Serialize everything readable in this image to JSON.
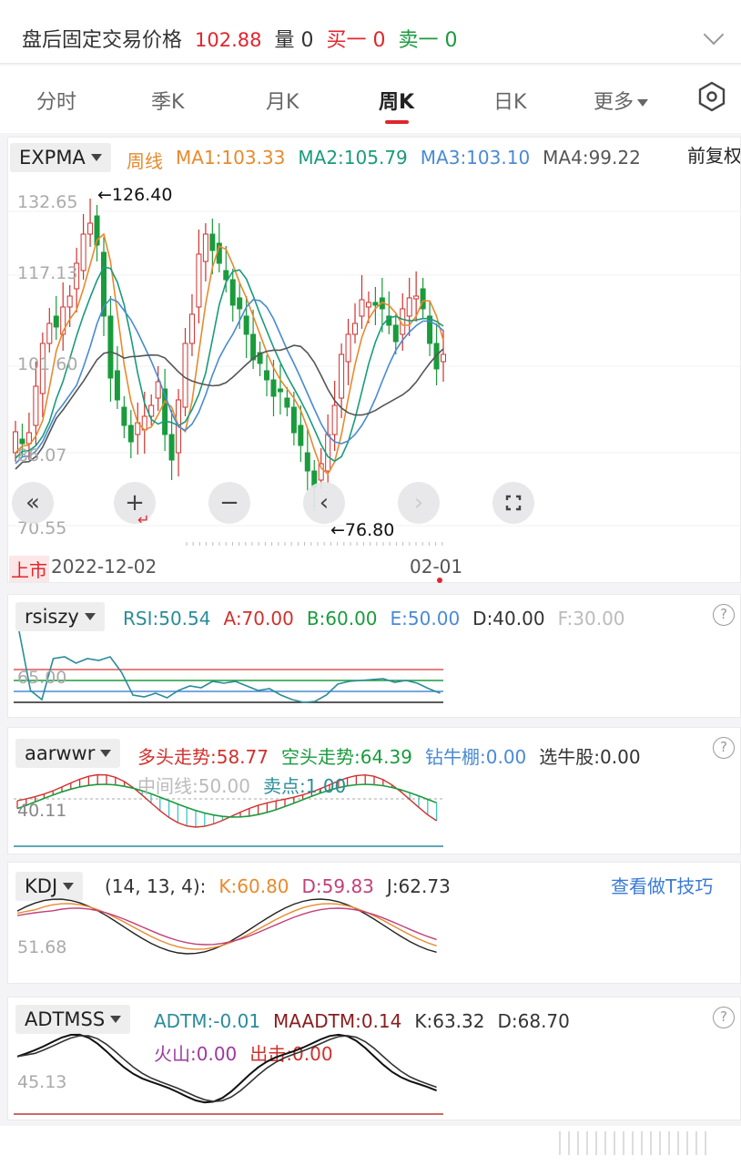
{
  "quote": {
    "after_hours_label": "盘后固定交易价格",
    "price": "102.88",
    "volume_label": "量",
    "volume": "0",
    "bid_label": "买一",
    "bid": "0",
    "ask_label": "卖一",
    "ask": "0"
  },
  "tabs": [
    {
      "label": "分时"
    },
    {
      "label": "季K"
    },
    {
      "label": "月K"
    },
    {
      "label": "周K"
    },
    {
      "label": "日K"
    },
    {
      "label": "更多"
    }
  ],
  "main_chart": {
    "indicator": "EXPMA",
    "period": "周线",
    "ma1": "MA1:103.33",
    "ma2": "MA2:105.79",
    "ma3": "MA3:103.10",
    "ma4": "MA4:99.22",
    "adjust": "前复权",
    "y_labels": [
      "132.65",
      "117.13",
      "101.60",
      "86.07",
      "70.55"
    ],
    "high_annotation": "←126.40",
    "low_annotation": "←76.80",
    "listed_label": "上市",
    "start_date": "2022-12-02",
    "end_date": "02-01",
    "controls": {
      "rewind": "«",
      "zoom_in": "+",
      "zoom_out": "−",
      "prev": "‹",
      "next": "›"
    },
    "colors": {
      "up": "#d0312d",
      "down": "#1a9b3c",
      "ma1": "#e88a2e",
      "ma2": "#1a9b7a",
      "ma3": "#4a8ad4",
      "ma4": "#555555"
    }
  },
  "rsi_panel": {
    "indicator": "rsiszy",
    "rsi": "RSI:50.54",
    "a": "A:70.00",
    "b": "B:60.00",
    "e": "E:50.00",
    "d": "D:40.00",
    "f": "F:30.00",
    "y_label": "65.00"
  },
  "aar_panel": {
    "indicator": "aarwwr",
    "bull": "多头走势:58.77",
    "bear": "空头走势:64.39",
    "drill": "钻牛棚:0.00",
    "pick": "选牛股:0.00",
    "mid": "中间线:50.00",
    "sell": "卖点:1.00",
    "y_label": "40.11"
  },
  "kdj_panel": {
    "indicator": "KDJ",
    "params": "(14, 13, 4):",
    "k": "K:60.80",
    "d": "D:59.83",
    "j": "J:62.73",
    "tip": "查看做T技巧",
    "y_label": "51.68"
  },
  "adtm_panel": {
    "indicator": "ADTMSS",
    "adtm": "ADTM:-0.01",
    "maadtm": "MAADTM:0.14",
    "k": "K:63.32",
    "d": "D:68.70",
    "volcano": "火山:0.00",
    "strike": "出击:0.00",
    "y_label": "45.13"
  },
  "help_icon": "?"
}
